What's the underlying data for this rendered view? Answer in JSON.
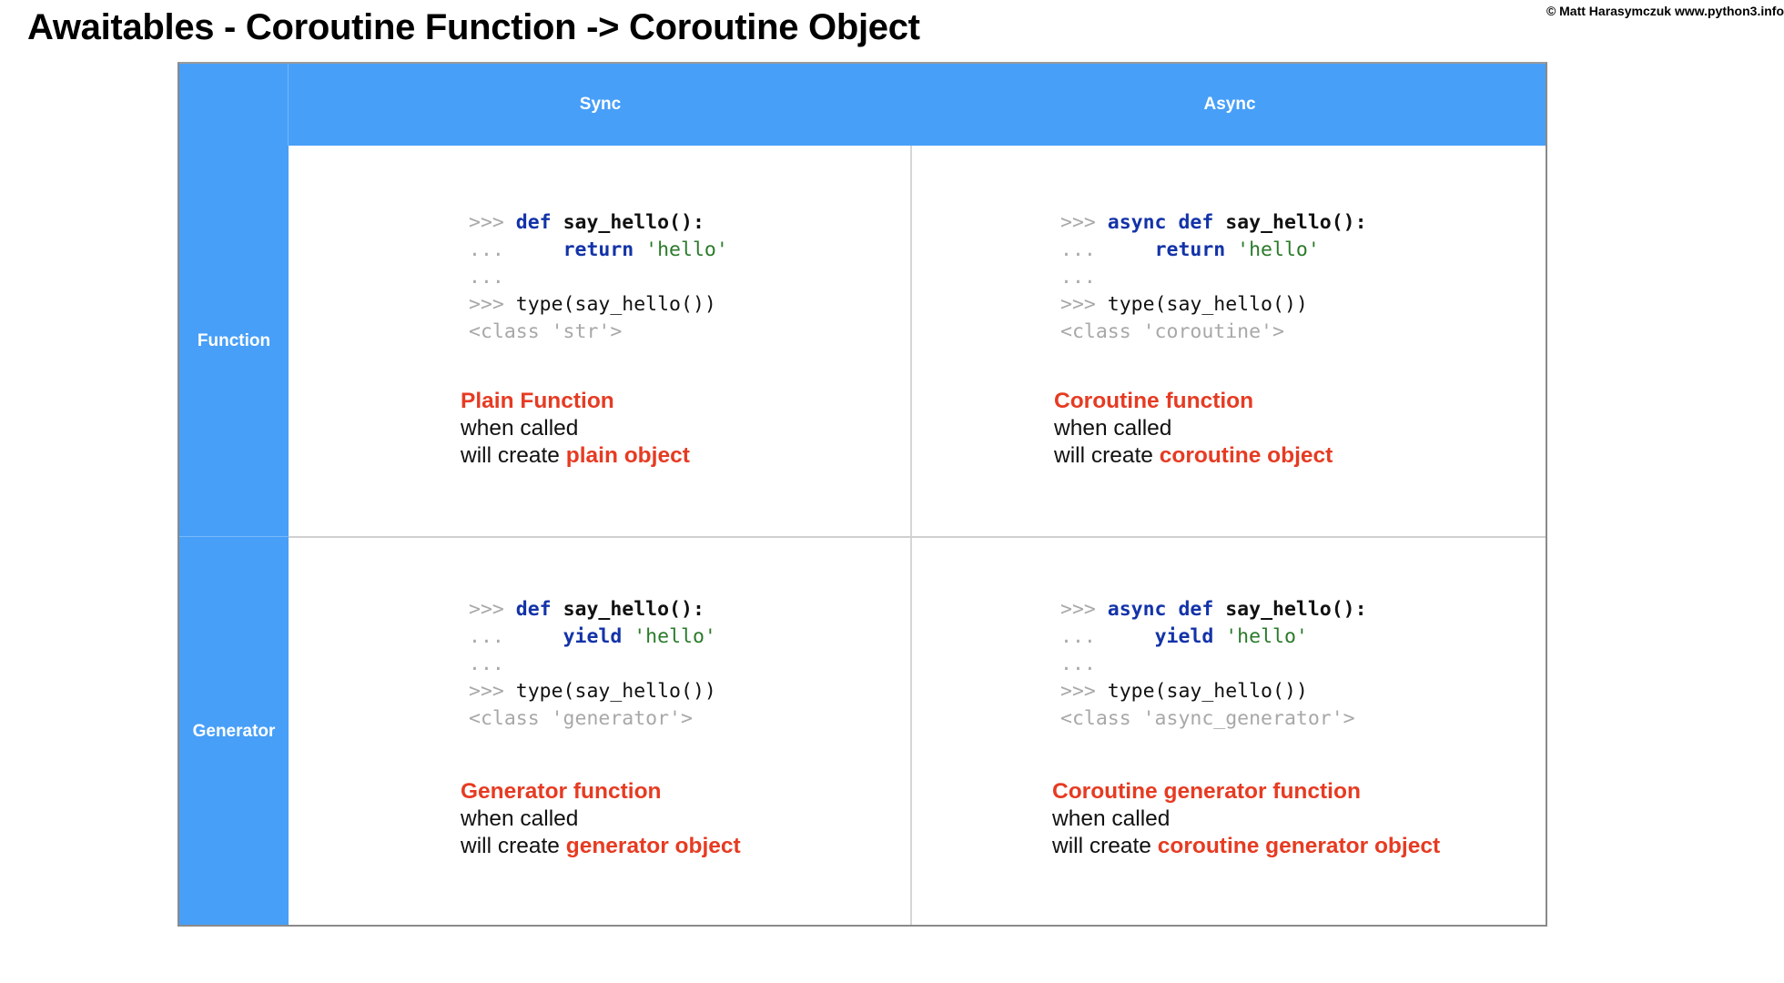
{
  "title": "Awaitables - Coroutine Function -> Coroutine Object",
  "credit": "© Matt Harasymczuk www.python3.info",
  "columns": [
    "Sync",
    "Async"
  ],
  "rows": [
    "Function",
    "Generator"
  ],
  "colors": {
    "header_bg": "#479ff8",
    "keyword": "#1333a8",
    "string": "#2a7a2a",
    "prompt": "#a8a8a8",
    "highlight": "#e63b22"
  },
  "cells": {
    "sync_function": {
      "line1": {
        "prompt": ">>> ",
        "kw": "def ",
        "name": "say_hello():"
      },
      "line2": {
        "prompt": "...     ",
        "kw": "return ",
        "str": "'hello'"
      },
      "line3": {
        "prompt": "..."
      },
      "line4": {
        "prompt": ">>> ",
        "code": "type(say_hello())"
      },
      "line5": {
        "output": "<class 'str'>"
      },
      "desc_title": "Plain Function",
      "desc_line2": "when called",
      "desc_prefix": "will create ",
      "desc_object": "plain object"
    },
    "async_function": {
      "line1": {
        "prompt": ">>> ",
        "kw": "async def ",
        "name": "say_hello():"
      },
      "line2": {
        "prompt": "...     ",
        "kw": "return ",
        "str": "'hello'"
      },
      "line3": {
        "prompt": "..."
      },
      "line4": {
        "prompt": ">>> ",
        "code": "type(say_hello())"
      },
      "line5": {
        "output": "<class 'coroutine'>"
      },
      "desc_title": "Coroutine function",
      "desc_line2": "when called",
      "desc_prefix": "will create ",
      "desc_object": "coroutine object"
    },
    "sync_generator": {
      "line1": {
        "prompt": ">>> ",
        "kw": "def ",
        "name": "say_hello():"
      },
      "line2": {
        "prompt": "...     ",
        "kw": "yield ",
        "str": "'hello'"
      },
      "line3": {
        "prompt": "..."
      },
      "line4": {
        "prompt": ">>> ",
        "code": "type(say_hello())"
      },
      "line5": {
        "output": "<class 'generator'>"
      },
      "desc_title": "Generator function",
      "desc_line2": "when called",
      "desc_prefix": "will create ",
      "desc_object": "generator object"
    },
    "async_generator": {
      "line1": {
        "prompt": ">>> ",
        "kw": "async def ",
        "name": "say_hello():"
      },
      "line2": {
        "prompt": "...     ",
        "kw": "yield ",
        "str": "'hello'"
      },
      "line3": {
        "prompt": "..."
      },
      "line4": {
        "prompt": ">>> ",
        "code": "type(say_hello())"
      },
      "line5": {
        "output": "<class 'async_generator'>"
      },
      "desc_title": "Coroutine generator function",
      "desc_line2": "when called",
      "desc_prefix": "will create ",
      "desc_object": "coroutine generator object"
    }
  }
}
